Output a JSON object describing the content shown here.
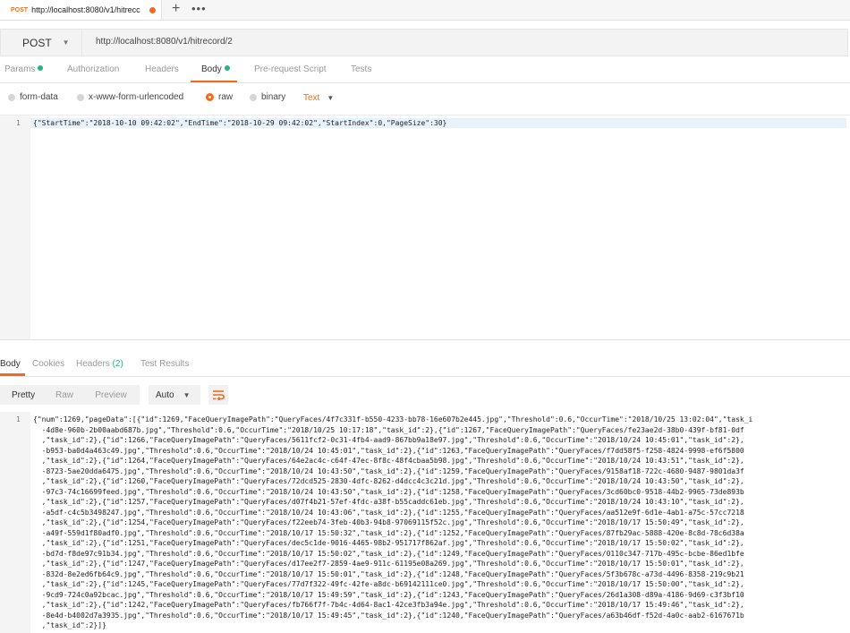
{
  "tab": {
    "method": "POST",
    "title": "http://localhost:8080/v1/hitrecc"
  },
  "toolbar": {
    "plus": "+",
    "more": "•••"
  },
  "request": {
    "method": "POST",
    "url": "http://localhost:8080/v1/hitrecord/2"
  },
  "request_tabs": [
    "Params",
    "Authorization",
    "Headers",
    "Body",
    "Pre-request Script",
    "Tests"
  ],
  "body_types": [
    "form-data",
    "x-www-form-urlencoded",
    "raw",
    "binary"
  ],
  "raw_type": "Text",
  "request_body": {
    "line_number": "1",
    "text": "{\"StartTime\":\"2018-10-10 09:42:02\",\"EndTime\":\"2018-10-29 09:42:02\",\"StartIndex\":0,\"PageSize\":30}"
  },
  "response_tabs": {
    "body": "Body",
    "cookies": "Cookies",
    "headers": "Headers",
    "headers_count": "(2)",
    "tests": "Test Results"
  },
  "format_buttons": {
    "pretty": "Pretty",
    "raw": "Raw",
    "preview": "Preview",
    "auto": "Auto"
  },
  "response_body": {
    "line_number": "1",
    "lines": [
      "{\"num\":1269,\"pageData\":[{\"id\":1269,\"FaceQueryImagePath\":\"QueryFaces/4f7c331f-b550-4233-bb78-16e607b2e445.jpg\",\"Threshold\":0.6,\"OccurTime\":\"2018/10/25 13:02:04\",\"task_i",
      "  -4d8e-960b-2b00aabd687b.jpg\",\"Threshold\":0.6,\"OccurTime\":\"2018/10/25 10:17:18\",\"task_id\":2},{\"id\":1267,\"FaceQueryImagePath\":\"QueryFaces/fe23ae2d-38b0-439f-bf81-0df",
      "  ,\"task_id\":2},{\"id\":1266,\"FaceQueryImagePath\":\"QueryFaces/5611fcf2-0c31-4fb4-aad9-867bb9a18e97.jpg\",\"Threshold\":0.6,\"OccurTime\":\"2018/10/24 10:45:01\",\"task_id\":2},",
      "  -b953-ba0d4a463c49.jpg\",\"Threshold\":0.6,\"OccurTime\":\"2018/10/24 10:45:01\",\"task_id\":2},{\"id\":1263,\"FaceQueryImagePath\":\"QueryFaces/f7dd58f5-f258-4824-9998-ef6f5800",
      "  ,\"task_id\":2},{\"id\":1264,\"FaceQueryImagePath\":\"QueryFaces/64e2ac4c-c64f-47ec-8f8c-48f4cbaa5b98.jpg\",\"Threshold\":0.6,\"OccurTime\":\"2018/10/24 10:43:51\",\"task_id\":2},",
      "  -8723-5ae20dda6475.jpg\",\"Threshold\":0.6,\"OccurTime\":\"2018/10/24 10:43:50\",\"task_id\":2},{\"id\":1259,\"FaceQueryImagePath\":\"QueryFaces/9158af18-722c-4680-9487-9801da3f",
      "  ,\"task_id\":2},{\"id\":1260,\"FaceQueryImagePath\":\"QueryFaces/72dcd525-2830-4dfc-8262-d4dcc4c3c21d.jpg\",\"Threshold\":0.6,\"OccurTime\":\"2018/10/24 10:43:50\",\"task_id\":2},",
      "  -97c3-74c16699feed.jpg\",\"Threshold\":0.6,\"OccurTime\":\"2018/10/24 10:43:50\",\"task_id\":2},{\"id\":1258,\"FaceQueryImagePath\":\"QueryFaces/3cd60bc0-9518-44b2-9965-73de893b",
      "  ,\"task_id\":2},{\"id\":1257,\"FaceQueryImagePath\":\"QueryFaces/d07f4b21-57ef-4fdc-a38f-b55caddc61eb.jpg\",\"Threshold\":0.6,\"OccurTime\":\"2018/10/24 10:43:10\",\"task_id\":2},",
      "  -a5df-c4c5b3498247.jpg\",\"Threshold\":0.6,\"OccurTime\":\"2018/10/24 10:43:06\",\"task_id\":2},{\"id\":1255,\"FaceQueryImagePath\":\"QueryFaces/aa512e9f-6d1e-4ab1-a75c-57cc7218",
      "  ,\"task_id\":2},{\"id\":1254,\"FaceQueryImagePath\":\"QueryFaces/f22eeb74-3feb-40b3-94b8-97069115f52c.jpg\",\"Threshold\":0.6,\"OccurTime\":\"2018/10/17 15:50:49\",\"task_id\":2},",
      "  -a49f-559d1f80adf0.jpg\",\"Threshold\":0.6,\"OccurTime\":\"2018/10/17 15:50:32\",\"task_id\":2},{\"id\":1252,\"FaceQueryImagePath\":\"QueryFaces/87fb29ac-5888-420e-8c8d-78c6d38a",
      "  ,\"task_id\":2},{\"id\":1251,\"FaceQueryImagePath\":\"QueryFaces/dec5c1de-9016-4465-98b2-951717f862af.jpg\",\"Threshold\":0.6,\"OccurTime\":\"2018/10/17 15:50:02\",\"task_id\":2},",
      "  -bd7d-f8de97c91b34.jpg\",\"Threshold\":0.6,\"OccurTime\":\"2018/10/17 15:50:02\",\"task_id\":2},{\"id\":1249,\"FaceQueryImagePath\":\"QueryFaces/0110c347-717b-495c-bcbe-86ed1bfe",
      "  ,\"task_id\":2},{\"id\":1247,\"FaceQueryImagePath\":\"QueryFaces/d17ee2f7-2859-4ae9-911c-61195e08a269.jpg\",\"Threshold\":0.6,\"OccurTime\":\"2018/10/17 15:50:01\",\"task_id\":2},",
      "  -832d-8e2ed6fb64c9.jpg\",\"Threshold\":0.6,\"OccurTime\":\"2018/10/17 15:50:01\",\"task_id\":2},{\"id\":1248,\"FaceQueryImagePath\":\"QueryFaces/5f3b678c-a73d-4496-8358-219c9b21",
      "  ,\"task_id\":2},{\"id\":1245,\"FaceQueryImagePath\":\"QueryFaces/77d7f322-49fc-42fe-a8dc-b69142111ce0.jpg\",\"Threshold\":0.6,\"OccurTime\":\"2018/10/17 15:50:00\",\"task_id\":2},",
      "  -9cd9-724c0a92bcac.jpg\",\"Threshold\":0.6,\"OccurTime\":\"2018/10/17 15:49:59\",\"task_id\":2},{\"id\":1243,\"FaceQueryImagePath\":\"QueryFaces/26d1a308-d89a-4186-9d69-c3f3bf10",
      "  ,\"task_id\":2},{\"id\":1242,\"FaceQueryImagePath\":\"QueryFaces/fb766f7f-7b4c-4d64-8ac1-42ce3fb3a94e.jpg\",\"Threshold\":0.6,\"OccurTime\":\"2018/10/17 15:49:46\",\"task_id\":2},",
      "  -8e4d-b4002d7a3935.jpg\",\"Threshold\":0.6,\"OccurTime\":\"2018/10/17 15:49:45\",\"task_id\":2},{\"id\":1240,\"FaceQueryImagePath\":\"QueryFaces/a63b46df-f52d-4a0c-aab2-6167671b",
      "  ,\"task_id\":2}]}"
    ]
  },
  "colors": {
    "accent": "#f26b1d",
    "green": "#26b47f"
  }
}
